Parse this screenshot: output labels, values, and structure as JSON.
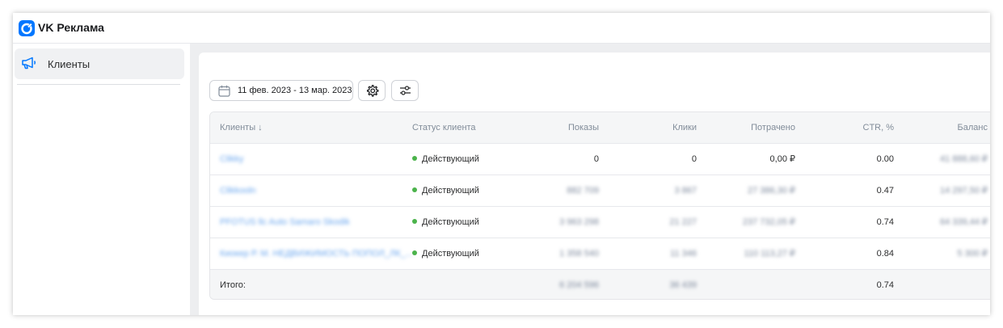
{
  "app": {
    "brand": "VK Реклама",
    "accent": "#0077ff"
  },
  "sidebar": {
    "items": [
      {
        "label": "Клиенты",
        "icon": "megaphone-icon"
      }
    ]
  },
  "toolbar": {
    "date_range": "11 фев. 2023 - 13 мар. 2023",
    "date_icon": "calendar-icon",
    "settings_icon": "gear-icon",
    "filter_icon": "sliders-icon"
  },
  "table": {
    "columns": [
      "Клиенты ↓",
      "Статус клиента",
      "Показы",
      "Клики",
      "Потрачено",
      "CTR, %",
      "Баланс"
    ],
    "rows": [
      {
        "client": "Сlikky",
        "status": "Действующий",
        "views": "0",
        "clicks": "0",
        "spent": "0,00 ₽",
        "ctr": "0.00",
        "balance": "41 888,60 ₽"
      },
      {
        "client": "Сlikkooln",
        "status": "Действующий",
        "views": "882 709",
        "clicks": "3 867",
        "spent": "27 386,30 ₽",
        "ctr": "0.47",
        "balance": "14 297,50 ₽"
      },
      {
        "client": "PFOTUS llc Auto Samaro Skodik",
        "status": "Действующий",
        "views": "3 963 298",
        "clicks": "21 227",
        "spent": "237 732,05 ₽",
        "ctr": "0.74",
        "balance": "64 339,44 ₽"
      },
      {
        "client": "Киокер Р. М. НЕДВИЖИМОСТЬ ПОПОЛ_ЛК_...",
        "status": "Действующий",
        "views": "1 358 540",
        "clicks": "11 346",
        "spent": "110 113,27 ₽",
        "ctr": "0.84",
        "balance": "5 300 ₽"
      }
    ],
    "total": {
      "label": "Итого:",
      "views": "6 204 596",
      "clicks": "36 439",
      "ctr": "0.74"
    }
  }
}
